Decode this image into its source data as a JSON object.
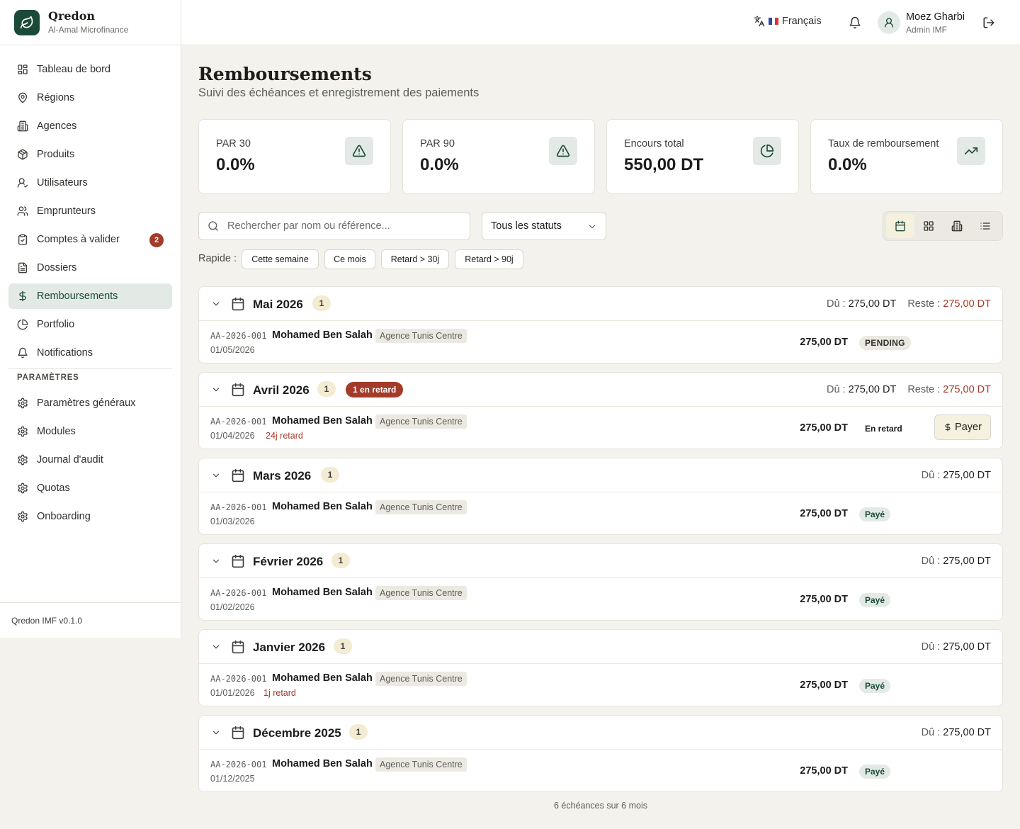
{
  "brand": {
    "name": "Qredon",
    "org": "Al-Amal Microfinance",
    "version": "Qredon IMF v0.1.0"
  },
  "nav": [
    {
      "label": "Tableau de bord",
      "icon": "dashboard-icon"
    },
    {
      "label": "Régions",
      "icon": "map-pin-icon"
    },
    {
      "label": "Agences",
      "icon": "building-icon"
    },
    {
      "label": "Produits",
      "icon": "package-icon"
    },
    {
      "label": "Utilisateurs",
      "icon": "user-check-icon"
    },
    {
      "label": "Emprunteurs",
      "icon": "users-icon"
    },
    {
      "label": "Comptes à valider",
      "icon": "clipboard-check-icon",
      "badge": "2"
    },
    {
      "label": "Dossiers",
      "icon": "file-icon"
    },
    {
      "label": "Remboursements",
      "icon": "dollar-icon",
      "active": true
    },
    {
      "label": "Portfolio",
      "icon": "pie-chart-icon"
    },
    {
      "label": "Notifications",
      "icon": "bell-icon"
    }
  ],
  "settings_section": "PARAMÈTRES",
  "settings_nav": [
    {
      "label": "Paramètres généraux",
      "icon": "gear-icon"
    },
    {
      "label": "Modules",
      "icon": "gear-icon"
    },
    {
      "label": "Journal d'audit",
      "icon": "gear-icon"
    },
    {
      "label": "Quotas",
      "icon": "gear-icon"
    },
    {
      "label": "Onboarding",
      "icon": "gear-icon"
    }
  ],
  "topbar": {
    "language": "Français",
    "user_name": "Moez Gharbi",
    "user_role": "Admin IMF"
  },
  "page": {
    "title": "Remboursements",
    "subtitle": "Suivi des échéances et enregistrement des paiements"
  },
  "kpis": [
    {
      "label": "PAR 30",
      "value": "0.0%",
      "icon": "alert-triangle-icon"
    },
    {
      "label": "PAR 90",
      "value": "0.0%",
      "icon": "alert-triangle-icon"
    },
    {
      "label": "Encours total",
      "value": "550,00 DT",
      "icon": "pie-chart-icon"
    },
    {
      "label": "Taux de remboursement",
      "value": "0.0%",
      "icon": "trending-up-icon"
    }
  ],
  "filters": {
    "search_placeholder": "Rechercher par nom ou référence...",
    "status": "Tous les statuts",
    "quick_label": "Rapide :",
    "quick": [
      "Cette semaine",
      "Ce mois",
      "Retard > 30j",
      "Retard > 90j"
    ]
  },
  "labels": {
    "due": "Dû :",
    "remaining": "Reste :",
    "pay": "Payer"
  },
  "groups": [
    {
      "month": "Mai 2026",
      "count": "1",
      "late_badge": "",
      "due": "275,00 DT",
      "remaining": "275,00 DT",
      "row": {
        "ref": "AA-2026-001",
        "name": "Mohamed Ben Salah",
        "agency": "Agence Tunis Centre",
        "date": "01/05/2026",
        "late": "",
        "amount": "275,00 DT",
        "status": "PENDING",
        "status_kind": "pending",
        "pay": false
      }
    },
    {
      "month": "Avril 2026",
      "count": "1",
      "late_badge": "1 en retard",
      "due": "275,00 DT",
      "remaining": "275,00 DT",
      "row": {
        "ref": "AA-2026-001",
        "name": "Mohamed Ben Salah",
        "agency": "Agence Tunis Centre",
        "date": "01/04/2026",
        "late": "24j retard",
        "amount": "275,00 DT",
        "status": "En retard",
        "status_kind": "late",
        "pay": true
      }
    },
    {
      "month": "Mars 2026",
      "count": "1",
      "late_badge": "",
      "due": "275,00 DT",
      "remaining": "",
      "row": {
        "ref": "AA-2026-001",
        "name": "Mohamed Ben Salah",
        "agency": "Agence Tunis Centre",
        "date": "01/03/2026",
        "late": "",
        "amount": "275,00 DT",
        "status": "Payé",
        "status_kind": "paid",
        "pay": false
      }
    },
    {
      "month": "Février 2026",
      "count": "1",
      "late_badge": "",
      "due": "275,00 DT",
      "remaining": "",
      "row": {
        "ref": "AA-2026-001",
        "name": "Mohamed Ben Salah",
        "agency": "Agence Tunis Centre",
        "date": "01/02/2026",
        "late": "",
        "amount": "275,00 DT",
        "status": "Payé",
        "status_kind": "paid",
        "pay": false
      }
    },
    {
      "month": "Janvier 2026",
      "count": "1",
      "late_badge": "",
      "due": "275,00 DT",
      "remaining": "",
      "row": {
        "ref": "AA-2026-001",
        "name": "Mohamed Ben Salah",
        "agency": "Agence Tunis Centre",
        "date": "01/01/2026",
        "late": "1j retard",
        "amount": "275,00 DT",
        "status": "Payé",
        "status_kind": "paid",
        "pay": false
      }
    },
    {
      "month": "Décembre 2025",
      "count": "1",
      "late_badge": "",
      "due": "275,00 DT",
      "remaining": "",
      "row": {
        "ref": "AA-2026-001",
        "name": "Mohamed Ben Salah",
        "agency": "Agence Tunis Centre",
        "date": "01/12/2025",
        "late": "",
        "amount": "275,00 DT",
        "status": "Payé",
        "status_kind": "paid",
        "pay": false
      }
    }
  ],
  "footer_summary": "6 échéances sur 6 mois",
  "colors": {
    "primary": "#1c4a38",
    "danger": "#a33a2a",
    "background": "#f4f2ec"
  }
}
